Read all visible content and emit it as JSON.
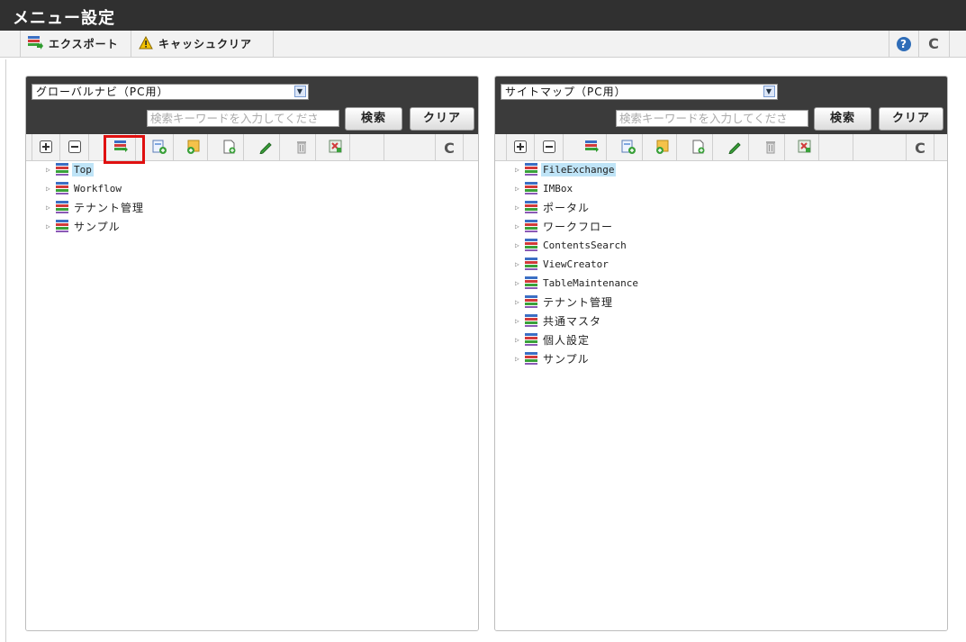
{
  "window": {
    "title": "メニュー設定"
  },
  "toolbar": {
    "export_label": "エクスポート",
    "cache_clear_label": "キャッシュクリア"
  },
  "left_panel": {
    "select_value": "グローバルナビ（PC用）",
    "search_placeholder": "検索キーワードを入力してくださ",
    "search_label": "検索",
    "clear_label": "クリア",
    "tree": [
      {
        "label": "Top",
        "selected": true
      },
      {
        "label": "Workflow"
      },
      {
        "label": "テナント管理"
      },
      {
        "label": "サンプル"
      }
    ]
  },
  "right_panel": {
    "select_value": "サイトマップ（PC用）",
    "search_placeholder": "検索キーワードを入力してくださ",
    "search_label": "検索",
    "clear_label": "クリア",
    "tree": [
      {
        "label": "FileExchange",
        "selected": true
      },
      {
        "label": "IMBox"
      },
      {
        "label": "ポータル"
      },
      {
        "label": "ワークフロー"
      },
      {
        "label": "ContentsSearch"
      },
      {
        "label": "ViewCreator"
      },
      {
        "label": "TableMaintenance"
      },
      {
        "label": "テナント管理"
      },
      {
        "label": "共通マスタ"
      },
      {
        "label": "個人設定"
      },
      {
        "label": "サンプル"
      }
    ]
  },
  "icons": [
    "export-icon",
    "warning-icon",
    "help-icon",
    "refresh-icon",
    "expand-all-icon",
    "collapse-all-icon",
    "add-menu-icon",
    "add-item-icon",
    "add-folder-icon",
    "new-page-icon",
    "edit-icon",
    "delete-icon",
    "convert-icon",
    "menu-item-icon"
  ],
  "colors": {
    "header_bg": "#303030",
    "panel_header_bg": "#3b3b3b",
    "selected_bg": "#bfe4f7",
    "highlight": "#e01010"
  }
}
